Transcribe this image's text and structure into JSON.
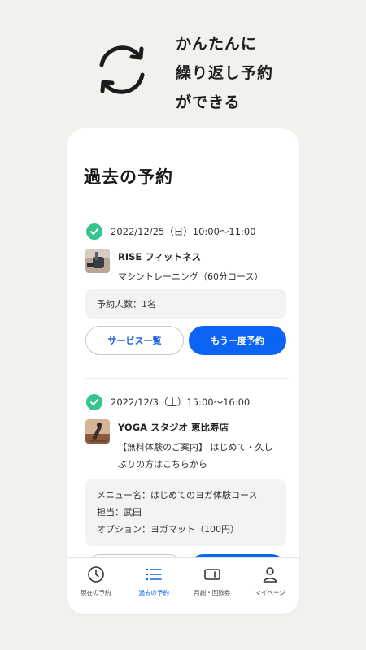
{
  "promo": {
    "lines": [
      "かんたんに",
      "繰り返し予約",
      "ができる"
    ],
    "icon": "refresh-icon"
  },
  "screen": {
    "title": "過去の予約",
    "bookings": [
      {
        "status_icon": "check-circle-icon",
        "date": "2022/12/25（日）10:00〜11:00",
        "shop": "RISE フィットネス",
        "service_lines": [
          "マシントレーニング（60分コース）"
        ],
        "details": [
          "予約人数：1名"
        ],
        "secondary_button": "サービス一覧",
        "primary_button": "もう一度予約"
      },
      {
        "status_icon": "check-circle-icon",
        "date": "2022/12/3（土）15:00〜16:00",
        "shop": "YOGA スタジオ 恵比寿店",
        "service_lines": [
          "【無料体験のご案内】 はじめて・久し",
          "ぶりの方はこちらから"
        ],
        "details": [
          "メニュー名：はじめてのヨガ体験コース",
          "担当：武田",
          "オプション：ヨガマット（100円）"
        ],
        "secondary_button": "",
        "primary_button": ""
      }
    ],
    "tabs": [
      {
        "label": "現在の予約",
        "icon": "clock-icon",
        "active": false
      },
      {
        "label": "過去の予約",
        "icon": "list-icon",
        "active": true
      },
      {
        "label": "月謝・回数券",
        "icon": "ticket-icon",
        "active": false
      },
      {
        "label": "マイページ",
        "icon": "person-icon",
        "active": false
      }
    ],
    "colors": {
      "accent": "#0b64f4",
      "success": "#35c48d",
      "background": "#f1f1ed"
    }
  }
}
